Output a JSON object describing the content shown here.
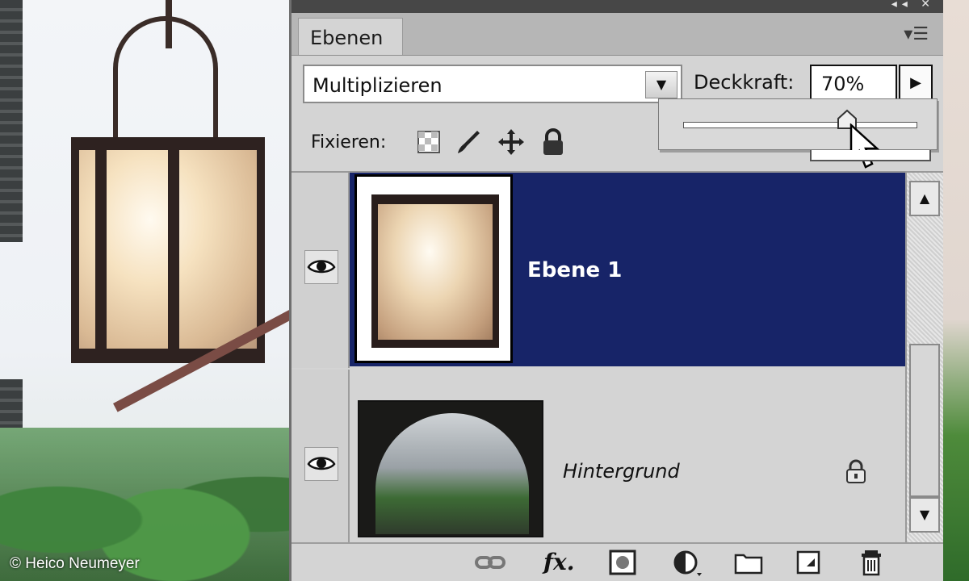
{
  "photo": {
    "credit": "© Heico Neumeyer"
  },
  "panel": {
    "tab_label": "Ebenen",
    "blend_mode": "Multiplizieren",
    "opacity_label": "Deckkraft:",
    "opacity_value": "70%",
    "opacity_slider_fraction": 0.7,
    "lock_label": "Fixieren:",
    "layers": [
      {
        "name": "Ebene 1",
        "selected": true,
        "visible": true
      },
      {
        "name": "Hintergrund",
        "selected": false,
        "visible": true,
        "locked": true
      }
    ]
  },
  "icons": {
    "lock_options": [
      "lock-transparent-pixels-icon",
      "lock-image-pixels-icon",
      "lock-position-icon",
      "lock-all-icon"
    ],
    "bottom_bar": [
      "link-layers-icon",
      "fx-icon",
      "layer-mask-icon",
      "adjustment-layer-icon",
      "new-group-icon",
      "new-layer-icon",
      "trash-icon"
    ]
  },
  "colors": {
    "selection": "#172468",
    "panel": "#d4d4d4",
    "titlebar": "#474747"
  }
}
